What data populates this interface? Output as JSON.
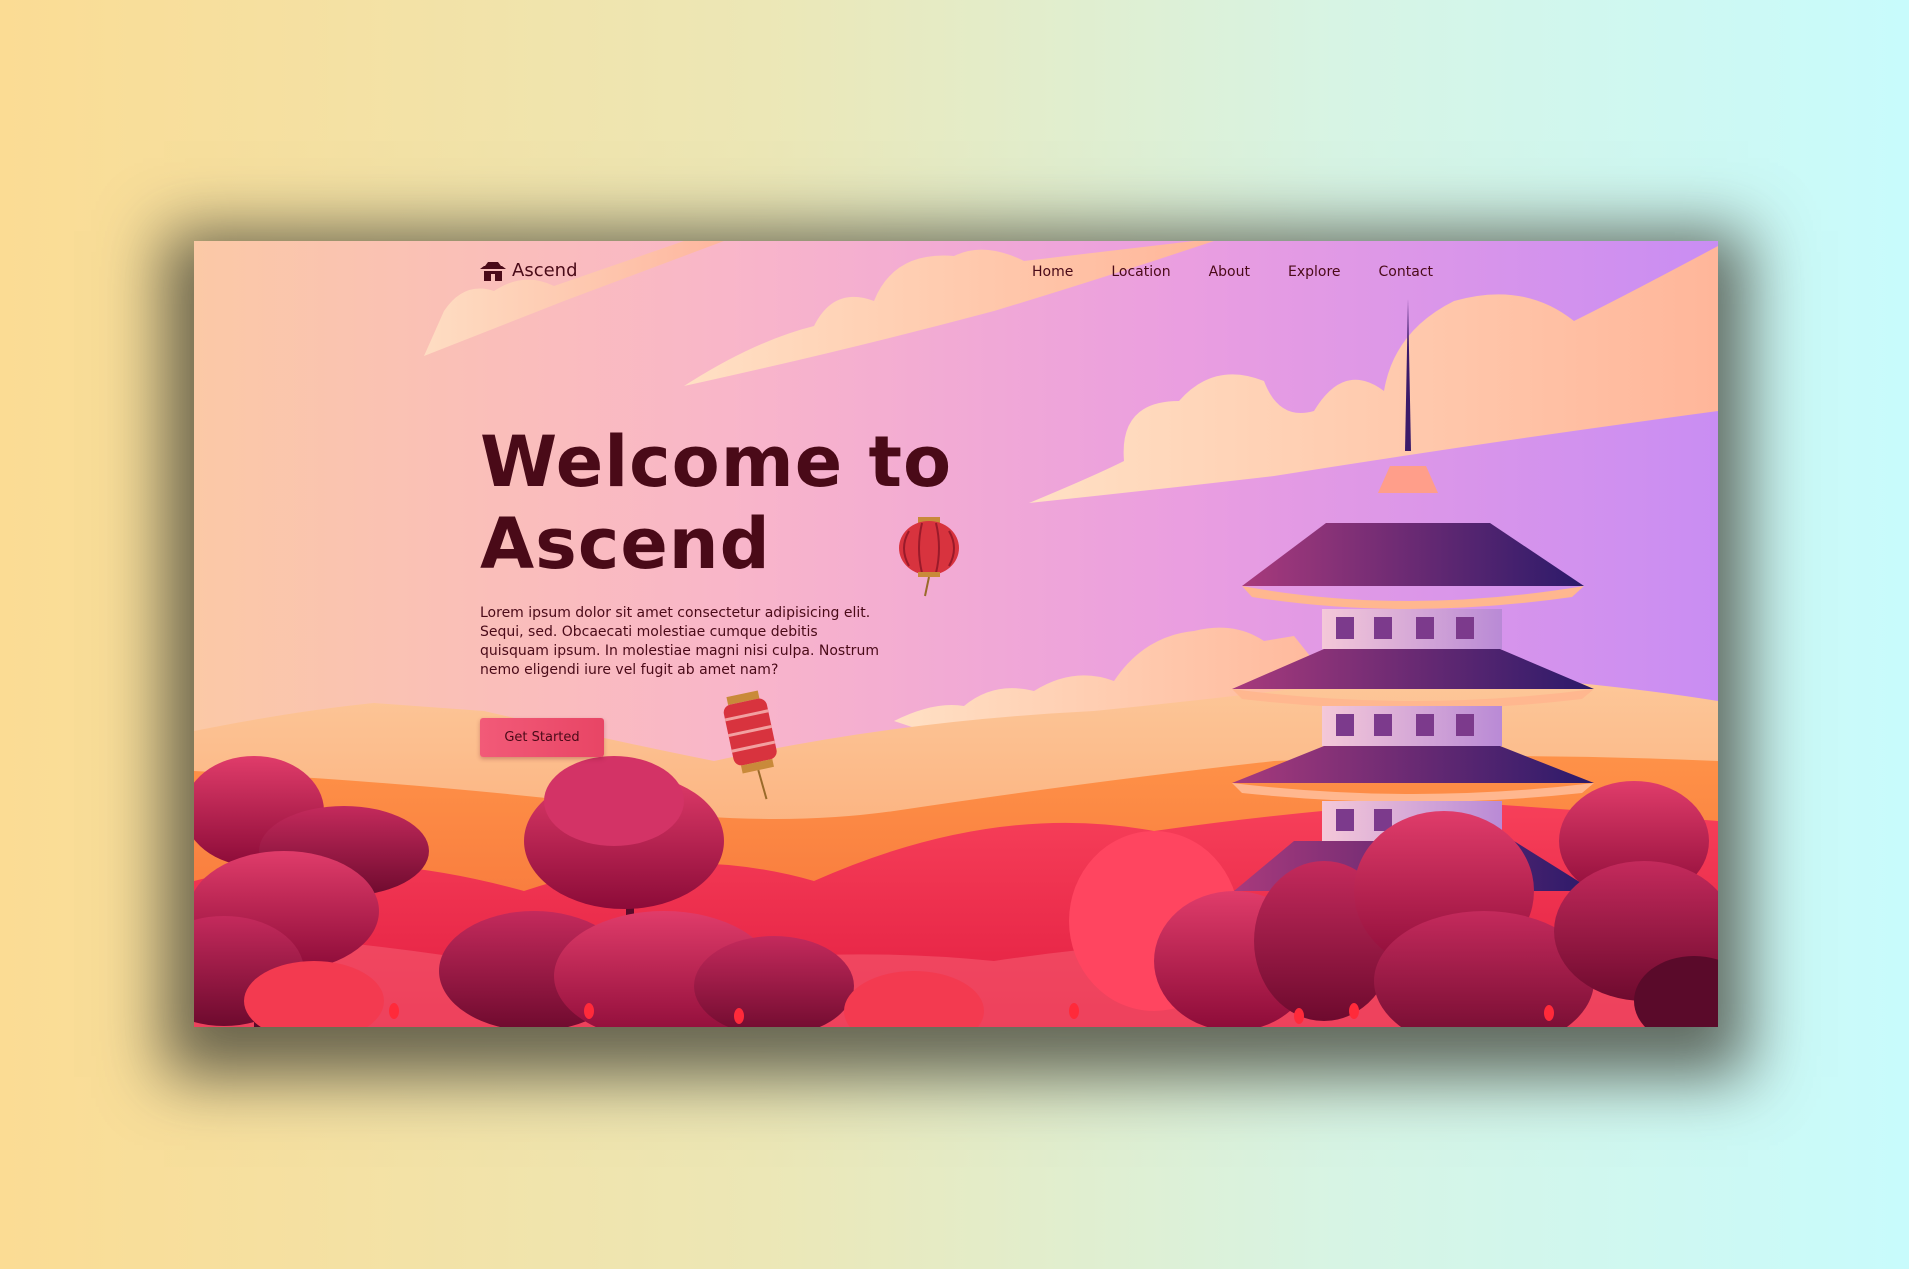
{
  "brand": {
    "name": "Ascend",
    "icon": "pagoda-icon"
  },
  "nav": {
    "items": [
      {
        "label": "Home"
      },
      {
        "label": "Location"
      },
      {
        "label": "About"
      },
      {
        "label": "Explore"
      },
      {
        "label": "Contact"
      }
    ]
  },
  "hero": {
    "title": "Welcome to Ascend",
    "text": "Lorem ipsum dolor sit amet consectetur adipisicing elit. Sequi, sed. Obcaecati molestiae cumque debitis quisquam ipsum. In molestiae magni nisi culpa. Nostrum nemo eligendi iure vel fugit ab amet nam?",
    "cta_label": "Get Started"
  },
  "colors": {
    "text": "#4a0a18",
    "accent": "#f25a78",
    "sky_left": "#fbc9a6",
    "sky_right": "#c98df3"
  }
}
